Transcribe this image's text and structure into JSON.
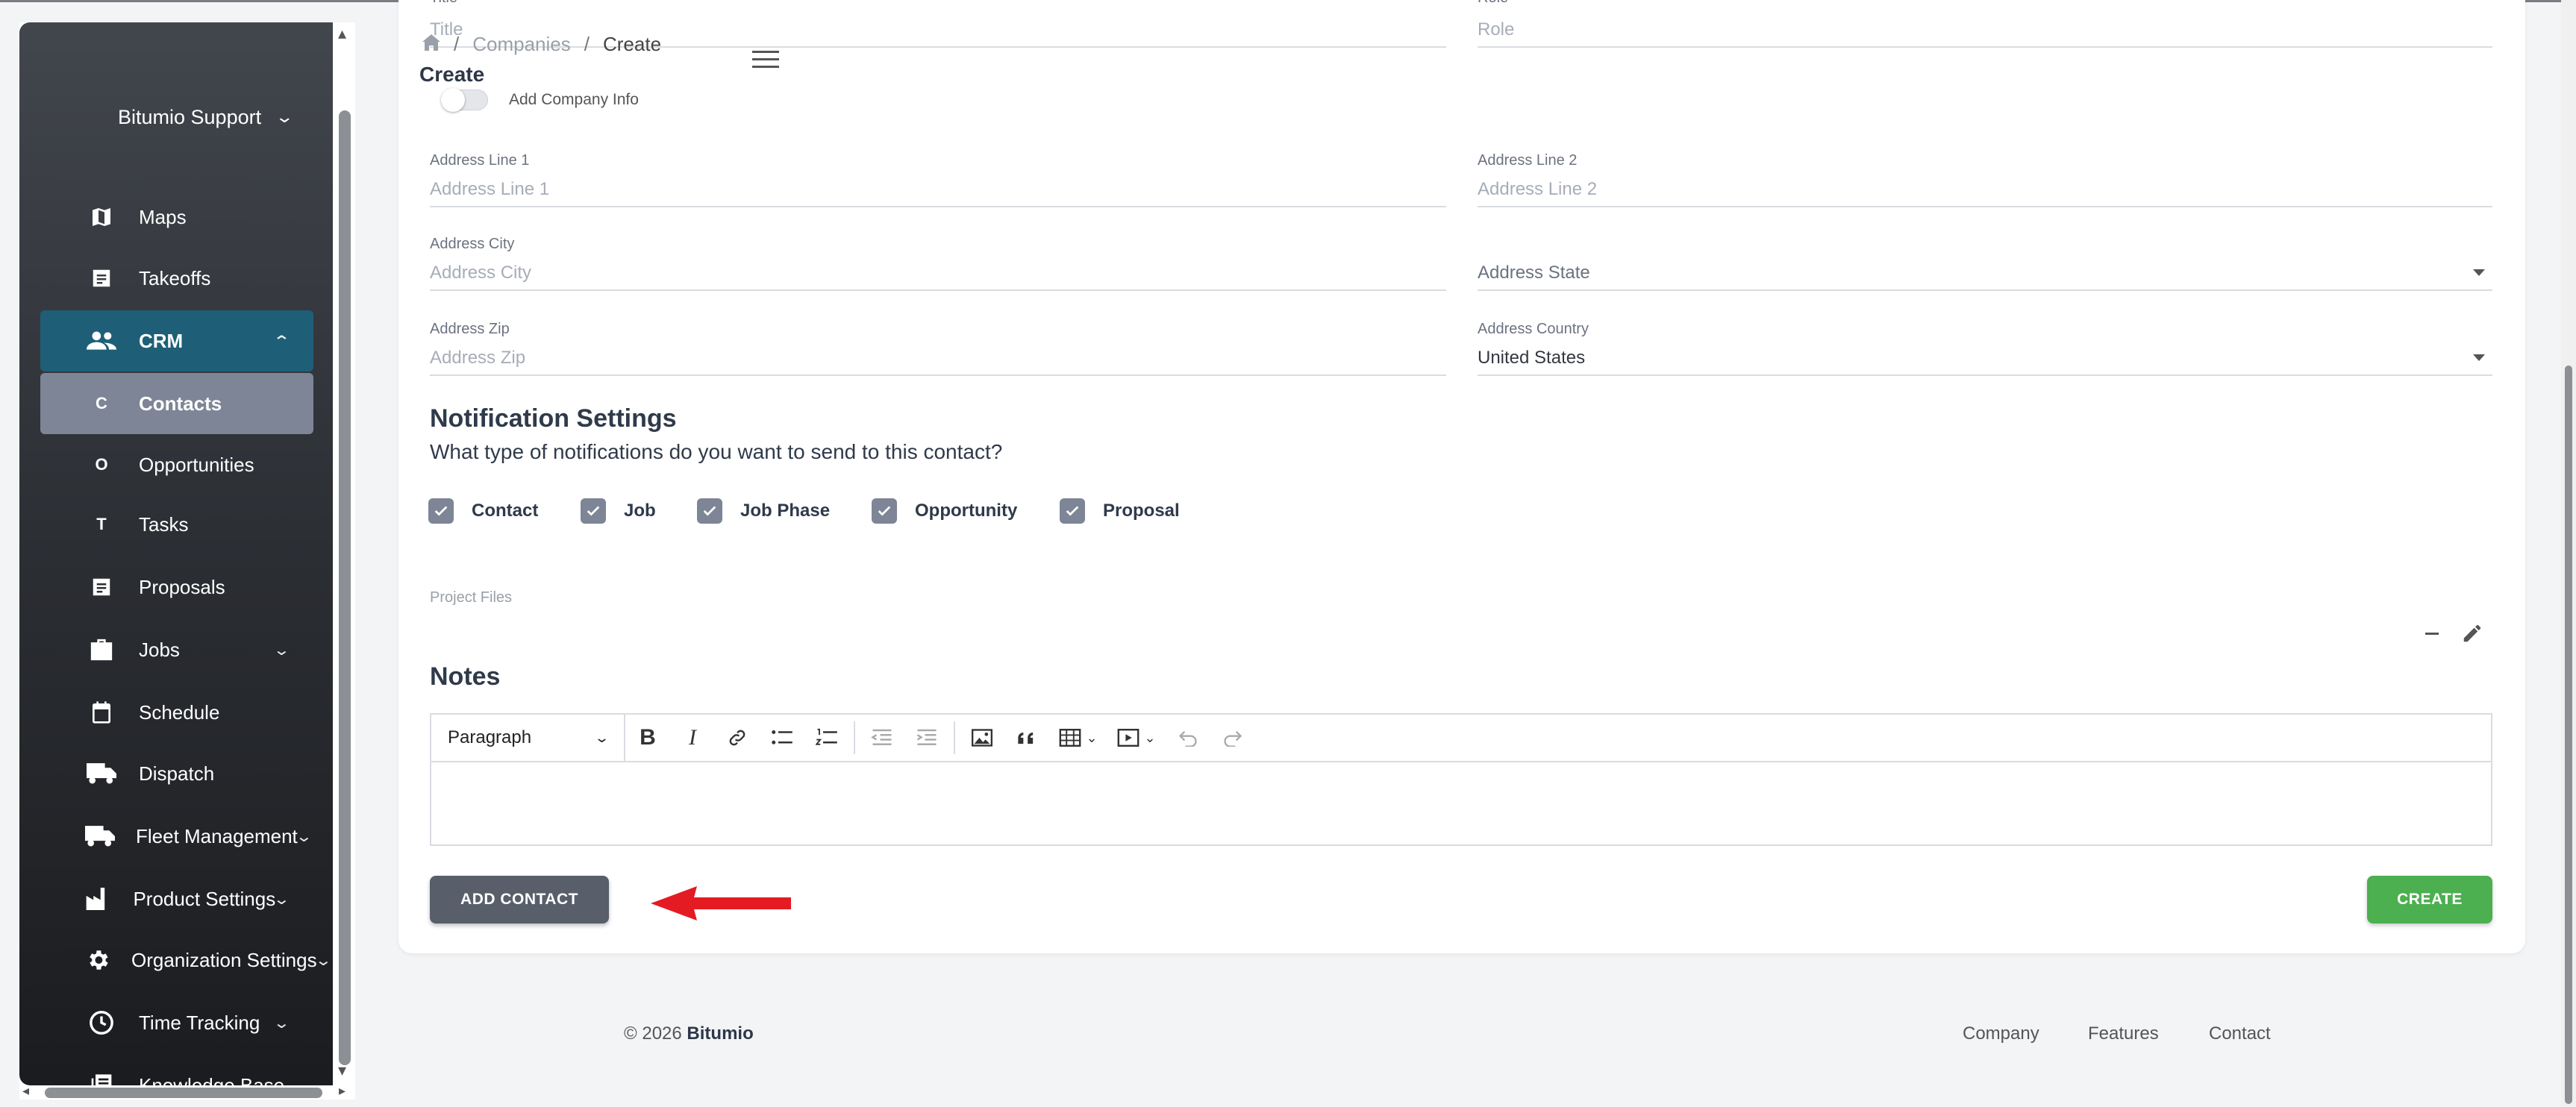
{
  "sidebar": {
    "org_name": "Bitumio Support",
    "items": [
      {
        "label": "Maps",
        "icon": "map-icon"
      },
      {
        "label": "Takeoffs",
        "icon": "document-icon"
      },
      {
        "label": "CRM",
        "icon": "people-icon"
      },
      {
        "label": "Contacts",
        "letter": "C"
      },
      {
        "label": "Opportunities",
        "letter": "O"
      },
      {
        "label": "Tasks",
        "letter": "T"
      },
      {
        "label": "Proposals",
        "icon": "document-icon"
      },
      {
        "label": "Jobs",
        "icon": "briefcase-icon"
      },
      {
        "label": "Schedule",
        "icon": "calendar-icon"
      },
      {
        "label": "Dispatch",
        "icon": "truck-icon"
      },
      {
        "label": "Fleet Management",
        "icon": "truck-icon"
      },
      {
        "label": "Product Settings",
        "icon": "factory-icon"
      },
      {
        "label": "Organization Settings",
        "icon": "gear-icon"
      },
      {
        "label": "Time Tracking",
        "icon": "clock-icon"
      },
      {
        "label": "Knowledge Base",
        "icon": "book-icon"
      }
    ]
  },
  "header": {
    "breadcrumb": [
      "Companies",
      "Create"
    ],
    "title": "Create"
  },
  "form": {
    "title": {
      "label": "Title",
      "placeholder": "Title"
    },
    "role": {
      "label": "Role",
      "placeholder": "Role"
    },
    "add_company_info": "Add Company Info",
    "address_line1": {
      "label": "Address Line 1",
      "placeholder": "Address Line 1"
    },
    "address_line2": {
      "label": "Address Line 2",
      "placeholder": "Address Line 2"
    },
    "address_city": {
      "label": "Address City",
      "placeholder": "Address City"
    },
    "address_state": {
      "placeholder": "Address State"
    },
    "address_zip": {
      "label": "Address Zip",
      "placeholder": "Address Zip"
    },
    "address_country": {
      "label": "Address Country",
      "value": "United States"
    }
  },
  "notifications": {
    "title": "Notification Settings",
    "subtitle": "What type of notifications do you want to send to this contact?",
    "options": [
      "Contact",
      "Job",
      "Job Phase",
      "Opportunity",
      "Proposal"
    ]
  },
  "files": {
    "label": "Project Files"
  },
  "notes": {
    "title": "Notes",
    "format": "Paragraph"
  },
  "actions": {
    "add_contact": "ADD CONTACT",
    "create": "CREATE"
  },
  "footer": {
    "copyright": "© 2026",
    "brand": "Bitumio",
    "links": [
      "Company",
      "Features",
      "Contact"
    ]
  },
  "colors": {
    "crm_active": "#1e5f77",
    "contacts_active": "#7d8596",
    "create_button": "#4caf50",
    "add_contact_button": "#585f6b",
    "annotation_arrow": "#e41b23"
  }
}
